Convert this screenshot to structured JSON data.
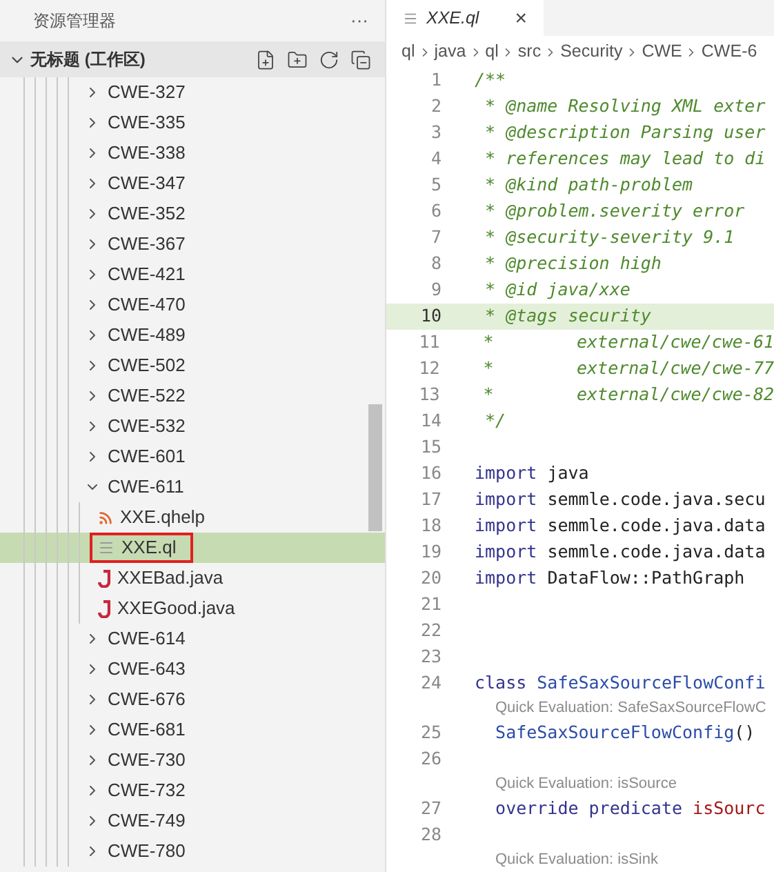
{
  "explorer": {
    "title": "资源管理器",
    "more": "···",
    "workspace": {
      "label": "无标题 (工作区)",
      "expanded": true
    },
    "items": [
      {
        "label": "CWE-327",
        "expanded": false,
        "selected": false
      },
      {
        "label": "CWE-335",
        "expanded": false,
        "selected": false
      },
      {
        "label": "CWE-338",
        "expanded": false,
        "selected": false
      },
      {
        "label": "CWE-347",
        "expanded": false,
        "selected": false
      },
      {
        "label": "CWE-352",
        "expanded": false,
        "selected": false
      },
      {
        "label": "CWE-367",
        "expanded": false,
        "selected": false
      },
      {
        "label": "CWE-421",
        "expanded": false,
        "selected": false
      },
      {
        "label": "CWE-470",
        "expanded": false,
        "selected": false
      },
      {
        "label": "CWE-489",
        "expanded": false,
        "selected": false
      },
      {
        "label": "CWE-502",
        "expanded": false,
        "selected": false
      },
      {
        "label": "CWE-522",
        "expanded": false,
        "selected": false
      },
      {
        "label": "CWE-532",
        "expanded": false,
        "selected": false
      },
      {
        "label": "CWE-601",
        "expanded": false,
        "selected": false
      },
      {
        "label": "CWE-611",
        "expanded": true,
        "selected": false,
        "children": [
          {
            "label": "XXE.qhelp",
            "kind": "qhelp",
            "selected": false,
            "outlined": false
          },
          {
            "label": "XXE.ql",
            "kind": "ql",
            "selected": true,
            "outlined": true
          },
          {
            "label": "XXEBad.java",
            "kind": "java",
            "selected": false,
            "outlined": false
          },
          {
            "label": "XXEGood.java",
            "kind": "java",
            "selected": false,
            "outlined": false
          }
        ]
      },
      {
        "label": "CWE-614",
        "expanded": false,
        "selected": false
      },
      {
        "label": "CWE-643",
        "expanded": false,
        "selected": false
      },
      {
        "label": "CWE-676",
        "expanded": false,
        "selected": false
      },
      {
        "label": "CWE-681",
        "expanded": false,
        "selected": false
      },
      {
        "label": "CWE-730",
        "expanded": false,
        "selected": false
      },
      {
        "label": "CWE-732",
        "expanded": false,
        "selected": false
      },
      {
        "label": "CWE-749",
        "expanded": false,
        "selected": false
      },
      {
        "label": "CWE-780",
        "expanded": false,
        "selected": false
      }
    ]
  },
  "tab": {
    "label": "XXE.ql",
    "close": "×"
  },
  "breadcrumb": [
    "ql",
    "java",
    "ql",
    "src",
    "Security",
    "CWE",
    "CWE-6"
  ],
  "code": [
    {
      "kind": "line",
      "number": "1",
      "highlighted": false,
      "tokens": [
        {
          "kind": "comment",
          "text": "/**"
        }
      ]
    },
    {
      "kind": "line",
      "number": "2",
      "highlighted": false,
      "tokens": [
        {
          "kind": "comment",
          "text": " * @name Resolving XML exter"
        }
      ]
    },
    {
      "kind": "line",
      "number": "3",
      "highlighted": false,
      "tokens": [
        {
          "kind": "comment",
          "text": " * @description Parsing user"
        }
      ]
    },
    {
      "kind": "line",
      "number": "4",
      "highlighted": false,
      "tokens": [
        {
          "kind": "comment",
          "text": " * references may lead to di"
        }
      ]
    },
    {
      "kind": "line",
      "number": "5",
      "highlighted": false,
      "tokens": [
        {
          "kind": "comment",
          "text": " * @kind path-problem"
        }
      ]
    },
    {
      "kind": "line",
      "number": "6",
      "highlighted": false,
      "tokens": [
        {
          "kind": "comment",
          "text": " * @problem.severity error"
        }
      ]
    },
    {
      "kind": "line",
      "number": "7",
      "highlighted": false,
      "tokens": [
        {
          "kind": "comment",
          "text": " * @security-severity 9.1"
        }
      ]
    },
    {
      "kind": "line",
      "number": "8",
      "highlighted": false,
      "tokens": [
        {
          "kind": "comment",
          "text": " * @precision high"
        }
      ]
    },
    {
      "kind": "line",
      "number": "9",
      "highlighted": false,
      "tokens": [
        {
          "kind": "comment",
          "text": " * @id java/xxe"
        }
      ]
    },
    {
      "kind": "line",
      "number": "10",
      "highlighted": true,
      "tokens": [
        {
          "kind": "comment",
          "text": " * @tags security"
        }
      ]
    },
    {
      "kind": "line",
      "number": "11",
      "highlighted": false,
      "tokens": [
        {
          "kind": "comment",
          "text": " *        external/cwe/cwe-61"
        }
      ]
    },
    {
      "kind": "line",
      "number": "12",
      "highlighted": false,
      "tokens": [
        {
          "kind": "comment",
          "text": " *        external/cwe/cwe-77"
        }
      ]
    },
    {
      "kind": "line",
      "number": "13",
      "highlighted": false,
      "tokens": [
        {
          "kind": "comment",
          "text": " *        external/cwe/cwe-82"
        }
      ]
    },
    {
      "kind": "line",
      "number": "14",
      "highlighted": false,
      "tokens": [
        {
          "kind": "comment",
          "text": " */"
        }
      ]
    },
    {
      "kind": "line",
      "number": "15",
      "highlighted": false
    },
    {
      "kind": "line",
      "number": "16",
      "highlighted": false,
      "tokens": [
        {
          "kind": "keyword",
          "text": "import "
        },
        {
          "kind": "plain",
          "text": "java"
        }
      ]
    },
    {
      "kind": "line",
      "number": "17",
      "highlighted": false,
      "tokens": [
        {
          "kind": "keyword",
          "text": "import "
        },
        {
          "kind": "plain",
          "text": "semmle.code.java.secu"
        }
      ]
    },
    {
      "kind": "line",
      "number": "18",
      "highlighted": false,
      "tokens": [
        {
          "kind": "keyword",
          "text": "import "
        },
        {
          "kind": "plain",
          "text": "semmle.code.java.data"
        }
      ]
    },
    {
      "kind": "line",
      "number": "19",
      "highlighted": false,
      "tokens": [
        {
          "kind": "keyword",
          "text": "import "
        },
        {
          "kind": "plain",
          "text": "semmle.code.java.data"
        }
      ]
    },
    {
      "kind": "line",
      "number": "20",
      "highlighted": false,
      "tokens": [
        {
          "kind": "keyword",
          "text": "import "
        },
        {
          "kind": "plain",
          "text": "DataFlow::PathGraph"
        }
      ]
    },
    {
      "kind": "line",
      "number": "21",
      "highlighted": false
    },
    {
      "kind": "line",
      "number": "22",
      "highlighted": false
    },
    {
      "kind": "line",
      "number": "23",
      "highlighted": false
    },
    {
      "kind": "line",
      "number": "24",
      "highlighted": false,
      "tokens": [
        {
          "kind": "keyword",
          "text": "class "
        },
        {
          "kind": "type",
          "text": "SafeSaxSourceFlowConfi"
        }
      ]
    },
    {
      "kind": "lens",
      "text": "Quick Evaluation: SafeSaxSourceFlowC"
    },
    {
      "kind": "line",
      "number": "25",
      "highlighted": false,
      "tokens": [
        {
          "kind": "type",
          "text": "  SafeSaxSourceFlowConfig"
        },
        {
          "kind": "plain",
          "text": "()"
        }
      ]
    },
    {
      "kind": "line",
      "number": "26",
      "highlighted": false
    },
    {
      "kind": "lens",
      "text": "Quick Evaluation: isSource"
    },
    {
      "kind": "line",
      "number": "27",
      "highlighted": false,
      "tokens": [
        {
          "kind": "keyword",
          "text": "  override predicate "
        },
        {
          "kind": "predicate",
          "text": "isSourc"
        }
      ]
    },
    {
      "kind": "line",
      "number": "28",
      "highlighted": false
    },
    {
      "kind": "lens",
      "text": "Quick Evaluation: isSink"
    }
  ]
}
